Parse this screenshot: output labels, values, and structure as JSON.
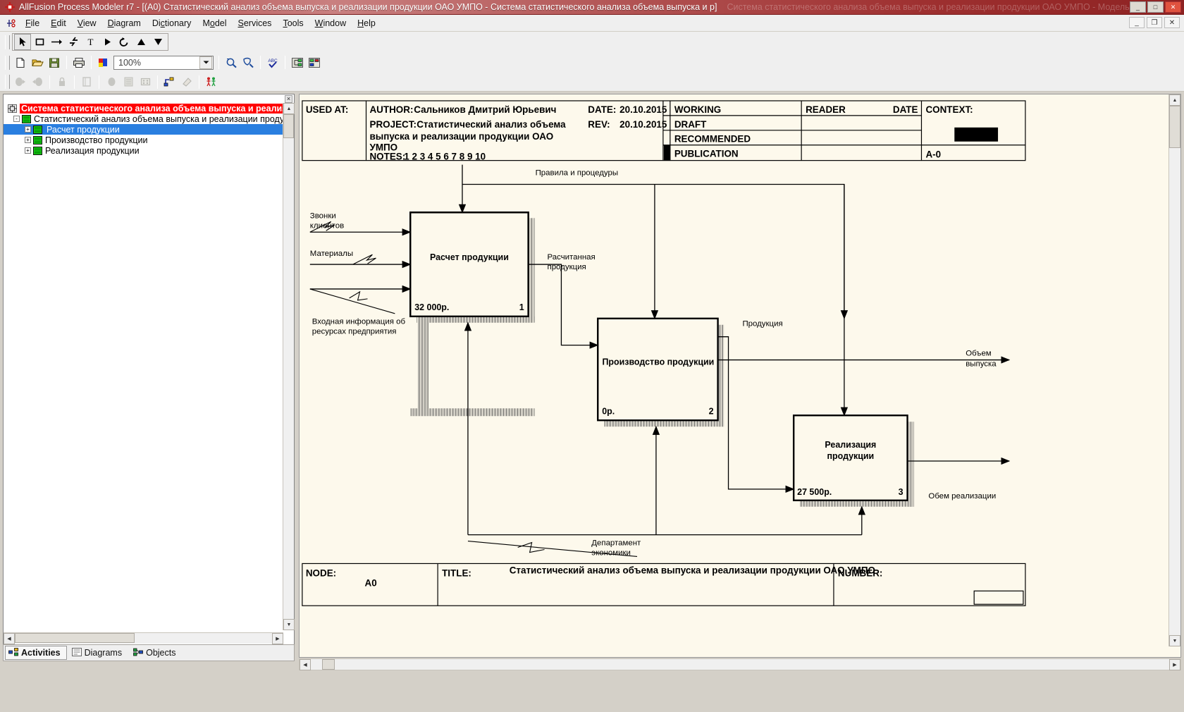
{
  "window": {
    "title": "AllFusion Process Modeler r7 - [(A0) Статистический анализ объема выпуска и реализации продукции ОАО УМПО - Система статистического анализа объема выпуска и р]",
    "ghost_title": "Система статистического анализа объема выпуска и реализации продукции ОАО УМПО - Модель",
    "minimize": "_",
    "maximize": "□",
    "close": "✕",
    "mdi_minimize": "_",
    "mdi_restore": "❐",
    "mdi_close": "✕"
  },
  "menu": {
    "items": [
      {
        "label": "File",
        "accel": "F"
      },
      {
        "label": "Edit",
        "accel": "E"
      },
      {
        "label": "View",
        "accel": "V"
      },
      {
        "label": "Diagram",
        "accel": "D"
      },
      {
        "label": "Dictionary",
        "accel": "c"
      },
      {
        "label": "Model",
        "accel": "o"
      },
      {
        "label": "Services",
        "accel": "S"
      },
      {
        "label": "Tools",
        "accel": "T"
      },
      {
        "label": "Window",
        "accel": "W"
      },
      {
        "label": "Help",
        "accel": "H"
      }
    ]
  },
  "toolbar": {
    "zoom_value": "100%",
    "tools": [
      {
        "name": "pointer-tool",
        "glyph": "pointer"
      },
      {
        "name": "activity-box-tool",
        "glyph": "square"
      },
      {
        "name": "arrow-tool",
        "glyph": "arrow"
      },
      {
        "name": "bolt-tool",
        "glyph": "bolt"
      },
      {
        "name": "text-tool",
        "glyph": "T"
      },
      {
        "name": "play-tool",
        "glyph": "play"
      },
      {
        "name": "rotate-tool",
        "glyph": "rotate"
      },
      {
        "name": "up-tool",
        "glyph": "triangle-up"
      },
      {
        "name": "down-tool",
        "glyph": "triangle-down"
      }
    ],
    "standard": [
      {
        "name": "new-file-button"
      },
      {
        "name": "open-folder-button"
      },
      {
        "name": "save-button"
      },
      {
        "name": "print-button"
      },
      {
        "name": "color-palette-button"
      },
      {
        "name": "zoom-in-button"
      },
      {
        "name": "zoom-fit-button"
      },
      {
        "name": "spellcheck-button"
      },
      {
        "name": "model-explorer-button"
      },
      {
        "name": "report-button"
      }
    ],
    "row3": [
      {
        "name": "go-to-parent-button"
      },
      {
        "name": "go-to-child-button"
      },
      {
        "name": "lock-button"
      },
      {
        "name": "dictionary-button"
      },
      {
        "name": "activity-props-button"
      },
      {
        "name": "decompose-button"
      },
      {
        "name": "grid-button"
      },
      {
        "name": "swim-lane-button"
      },
      {
        "name": "paint-button"
      },
      {
        "name": "actors-button"
      }
    ]
  },
  "tree": {
    "root": "Система статистического анализа объема выпуска и реализаци",
    "nodes": [
      {
        "label": "Статистический анализ объема выпуска и реализации продукции ОАО У",
        "level": 1,
        "toggle": "-",
        "selected": false
      },
      {
        "label": "Расчет продукции",
        "level": 2,
        "toggle": "+",
        "selected": true
      },
      {
        "label": "Производство продукции",
        "level": 2,
        "toggle": "+",
        "selected": false
      },
      {
        "label": "Реализация  продукции",
        "level": 2,
        "toggle": "+",
        "selected": false
      }
    ]
  },
  "tabs": [
    {
      "label": "Activities",
      "icon": "activities-icon",
      "active": true
    },
    {
      "label": "Diagrams",
      "icon": "diagrams-icon",
      "active": false
    },
    {
      "label": "Objects",
      "icon": "objects-icon",
      "active": false
    }
  ],
  "diagram": {
    "header": {
      "used_at_label": "USED AT:",
      "author_label": "AUTHOR:",
      "author_value": "Сальников Дмитрий Юрьевич",
      "project_label": "PROJECT:",
      "project_value": "Статистический анализ объема выпуска и реализации продукции ОАО УМПО",
      "notes_label": "NOTES:",
      "notes_value": "1  2  3  4  5  6  7  8  9  10",
      "date_label": "DATE:",
      "date_value": "20.10.2015",
      "rev_label": "REV:",
      "rev_value": "20.10.2015",
      "status_rows": [
        "WORKING",
        "DRAFT",
        "RECOMMENDED",
        "PUBLICATION"
      ],
      "reader_label": "READER",
      "date_col_label": "DATE",
      "context_label": "CONTEXT:",
      "context_value": "A-0"
    },
    "footer": {
      "node_label": "NODE:",
      "node_value": "A0",
      "title_label": "TITLE:",
      "title_value": "Статистический анализ объема выпуска и реализации продукции ОАО УМПО",
      "number_label": "NUMBER:"
    },
    "boxes": [
      {
        "name": "Расчет продукции",
        "cost": "32 000р.",
        "number": "1"
      },
      {
        "name": "Производство продукции",
        "cost": "0р.",
        "number": "2"
      },
      {
        "name": "Реализация\nпродукции",
        "cost": "27 500р.",
        "number": "3"
      }
    ],
    "box3_line1": "Реализация",
    "box3_line2": "продукции",
    "arrows": [
      {
        "label": "Правила и процедуры",
        "kind": "control"
      },
      {
        "label": "Звонки\nклиентов",
        "kind": "input"
      },
      {
        "label": "Материалы",
        "kind": "input"
      },
      {
        "label": "Входная информация об\nресурсах предприятия",
        "kind": "input"
      },
      {
        "label": "Расчитанная\nпродукция",
        "kind": "output"
      },
      {
        "label": "Продукция",
        "kind": "output"
      },
      {
        "label": "Объем\nвыпуска",
        "kind": "output"
      },
      {
        "label": "Обем реализации",
        "kind": "output"
      },
      {
        "label": "Департамент\nэкономики",
        "kind": "mechanism"
      }
    ],
    "labels": {
      "rules": "Правила и процедуры",
      "calls_1": "Звонки",
      "calls_2": "клиентов",
      "materials": "Материалы",
      "input_info_1": "Входная информация об",
      "input_info_2": "ресурсах предприятия",
      "calculated_1": "Расчитанная",
      "calculated_2": "продукция",
      "product": "Продукция",
      "output_vol_1": "Объем",
      "output_vol_2": "выпуска",
      "sales_vol": "Обем реализации",
      "dept_1": "Департамент",
      "dept_2": "экономики"
    }
  },
  "colors": {
    "title_bar": "#a33a3a",
    "tree_root_highlight": "#ff0000",
    "tree_selection": "#2a7fe0",
    "canvas": "#fdf9ec",
    "chrome": "#efefef"
  }
}
